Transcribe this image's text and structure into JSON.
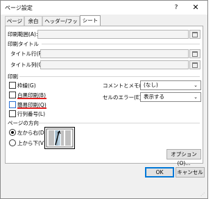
{
  "window": {
    "title": "ページ設定",
    "help": "?",
    "close": "✕"
  },
  "tabs": [
    {
      "label": "ページ"
    },
    {
      "label": "余白"
    },
    {
      "label": "ヘッダー/フッター"
    },
    {
      "label": "シート"
    }
  ],
  "print_area": {
    "label": "印刷範囲(A):"
  },
  "print_titles": {
    "section": "印刷タイトル",
    "rows_label": "タイトル行(R):",
    "cols_label": "タイトル列(C):"
  },
  "print": {
    "section": "印刷",
    "gridlines": "枠線(G)",
    "black_white": "白黒印刷(B)",
    "draft": "簡易印刷(Q)",
    "row_col_headers": "行列番号(L)",
    "comments_label": "コメントとメモ(M):",
    "comments_value": "(なし)",
    "errors_label": "セルのエラー(E):",
    "errors_value": "表示する"
  },
  "page_order": {
    "section": "ページの方向",
    "left_to_right": "左から右(D)",
    "top_to_bottom": "上から下(V)"
  },
  "buttons": {
    "options": "オプション(O)...",
    "ok": "OK",
    "cancel": "キャンセル"
  },
  "colors": {
    "accent": "#0078d7",
    "highlight": "#e02020"
  }
}
